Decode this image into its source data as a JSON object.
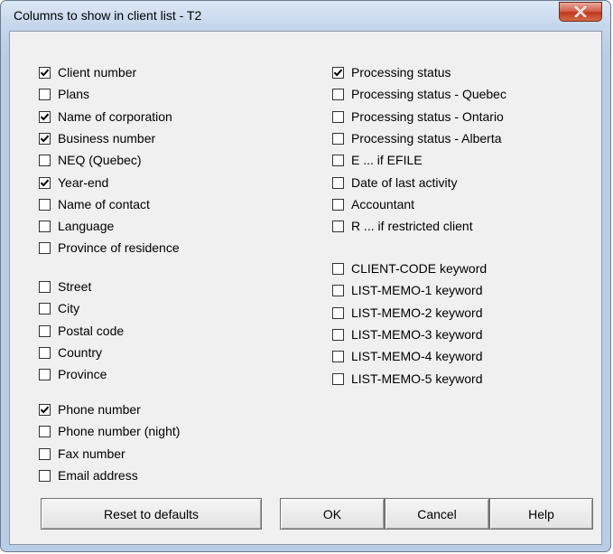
{
  "window": {
    "title": "Columns to show in client list - T2",
    "close_icon": "close-x-icon"
  },
  "left_column": [
    {
      "label": "Client number",
      "checked": true
    },
    {
      "label": "Plans",
      "checked": false
    },
    {
      "label": "Name of corporation",
      "checked": true
    },
    {
      "label": "Business number",
      "checked": true
    },
    {
      "label": "NEQ (Quebec)",
      "checked": false
    },
    {
      "label": "Year-end",
      "checked": true
    },
    {
      "label": "Name of contact",
      "checked": false
    },
    {
      "label": "Language",
      "checked": false
    },
    {
      "label": "Province of residence",
      "checked": false
    },
    {
      "label": "Street",
      "checked": false
    },
    {
      "label": "City",
      "checked": false
    },
    {
      "label": "Postal code",
      "checked": false
    },
    {
      "label": "Country",
      "checked": false
    },
    {
      "label": "Province",
      "checked": false
    },
    {
      "label": "Phone number",
      "checked": true
    },
    {
      "label": "Phone number (night)",
      "checked": false
    },
    {
      "label": "Fax number",
      "checked": false
    },
    {
      "label": "Email address",
      "checked": false
    }
  ],
  "right_column": [
    {
      "label": "Processing status",
      "checked": true
    },
    {
      "label": "Processing status - Quebec",
      "checked": false
    },
    {
      "label": "Processing status - Ontario",
      "checked": false
    },
    {
      "label": "Processing status - Alberta",
      "checked": false
    },
    {
      "label": "E ... if EFILE",
      "checked": false
    },
    {
      "label": "Date of last activity",
      "checked": false
    },
    {
      "label": "Accountant",
      "checked": false
    },
    {
      "label": "R ... if restricted client",
      "checked": false
    },
    {
      "label": "CLIENT-CODE keyword",
      "checked": false
    },
    {
      "label": "LIST-MEMO-1 keyword",
      "checked": false
    },
    {
      "label": "LIST-MEMO-2 keyword",
      "checked": false
    },
    {
      "label": "LIST-MEMO-3 keyword",
      "checked": false
    },
    {
      "label": "LIST-MEMO-4 keyword",
      "checked": false
    },
    {
      "label": "LIST-MEMO-5 keyword",
      "checked": false
    }
  ],
  "buttons": {
    "reset": "Reset to defaults",
    "ok": "OK",
    "cancel": "Cancel",
    "help": "Help"
  }
}
